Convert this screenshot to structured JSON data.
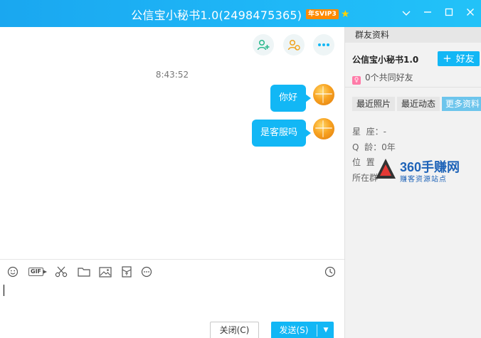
{
  "window": {
    "title": "公信宝小秘书1.0(2498475365)",
    "svip_badge": "年SVIP3",
    "controls": [
      "chevron-down",
      "minimize",
      "maximize",
      "close"
    ]
  },
  "chat": {
    "timestamp": "8:43:52",
    "messages": [
      {
        "text": "你好",
        "from": "self"
      },
      {
        "text": "是客服吗",
        "from": "self"
      }
    ],
    "top_actions": [
      "add-friend-icon",
      "add-group-icon",
      "more-icon"
    ]
  },
  "toolbar": {
    "items": [
      "emoji-icon",
      "gif-icon",
      "scissors-icon",
      "folder-icon",
      "image-icon",
      "red-packet-icon",
      "more-icon",
      "history-clock-icon"
    ],
    "gif_label": "GIF"
  },
  "buttons": {
    "close_label": "关闭(C)",
    "send_label": "发送(S)"
  },
  "sidebar": {
    "header": "群友资料",
    "name": "公信宝小秘书1.0",
    "add_friend_label": "好友",
    "common_friends": "0个共同好友",
    "tabs": [
      "最近照片",
      "最近动态",
      "更多资料"
    ],
    "active_tab": "更多资料",
    "info": [
      {
        "label": "星  座：",
        "value": "-"
      },
      {
        "label": "Q  龄：",
        "value": "0年"
      },
      {
        "label": "位  置",
        "value": ""
      },
      {
        "label": "所在群",
        "value": ""
      }
    ]
  },
  "watermark": {
    "title": "360手赚网",
    "subtitle": "赚客资源站点"
  },
  "colors": {
    "title_bar": "#1fb8f7",
    "bubble": "#12b7f5",
    "sidebar_bg": "#f2f2f2"
  }
}
